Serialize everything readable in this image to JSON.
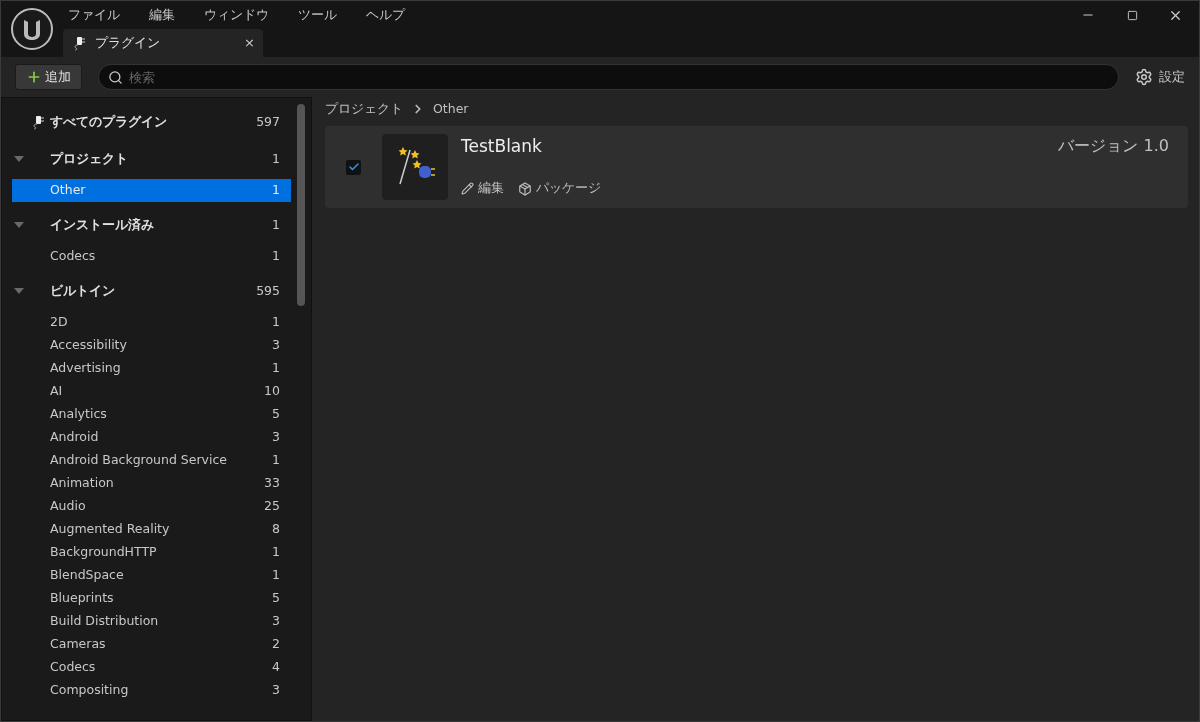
{
  "menu": [
    "ファイル",
    "編集",
    "ウィンドウ",
    "ツール",
    "ヘルプ"
  ],
  "tab": {
    "label": "プラグイン",
    "close": "×"
  },
  "toolbar": {
    "add_button": "追加",
    "search": {
      "placeholder": "検索"
    },
    "settings_button": "設定"
  },
  "sidebar": {
    "all_plugins": {
      "label": "すべてのプラグイン",
      "count": "597"
    },
    "sections": [
      {
        "label": "プロジェクト",
        "count": "1",
        "expanded": true,
        "children": [
          {
            "label": "Other",
            "count": "1",
            "selected": true
          }
        ]
      },
      {
        "label": "インストール済み",
        "count": "1",
        "expanded": true,
        "children": [
          {
            "label": "Codecs",
            "count": "1",
            "selected": false
          }
        ]
      },
      {
        "label": "ビルトイン",
        "count": "595",
        "expanded": true,
        "children": [
          {
            "label": "2D",
            "count": "1",
            "selected": false
          },
          {
            "label": "Accessibility",
            "count": "3",
            "selected": false
          },
          {
            "label": "Advertising",
            "count": "1",
            "selected": false
          },
          {
            "label": "AI",
            "count": "10",
            "selected": false
          },
          {
            "label": "Analytics",
            "count": "5",
            "selected": false
          },
          {
            "label": "Android",
            "count": "3",
            "selected": false
          },
          {
            "label": "Android Background Service",
            "count": "1",
            "selected": false
          },
          {
            "label": "Animation",
            "count": "33",
            "selected": false
          },
          {
            "label": "Audio",
            "count": "25",
            "selected": false
          },
          {
            "label": "Augmented Reality",
            "count": "8",
            "selected": false
          },
          {
            "label": "BackgroundHTTP",
            "count": "1",
            "selected": false
          },
          {
            "label": "BlendSpace",
            "count": "1",
            "selected": false
          },
          {
            "label": "Blueprints",
            "count": "5",
            "selected": false
          },
          {
            "label": "Build Distribution",
            "count": "3",
            "selected": false
          },
          {
            "label": "Cameras",
            "count": "2",
            "selected": false
          },
          {
            "label": "Codecs",
            "count": "4",
            "selected": false
          },
          {
            "label": "Compositing",
            "count": "3",
            "selected": false
          }
        ]
      }
    ]
  },
  "breadcrumb": [
    "プロジェクト",
    "Other"
  ],
  "plugins": [
    {
      "name": "TestBlank",
      "version": "バージョン 1.0",
      "enabled": true,
      "actions": [
        {
          "kind": "edit",
          "label": "編集"
        },
        {
          "kind": "package",
          "label": "パッケージ"
        }
      ]
    }
  ]
}
